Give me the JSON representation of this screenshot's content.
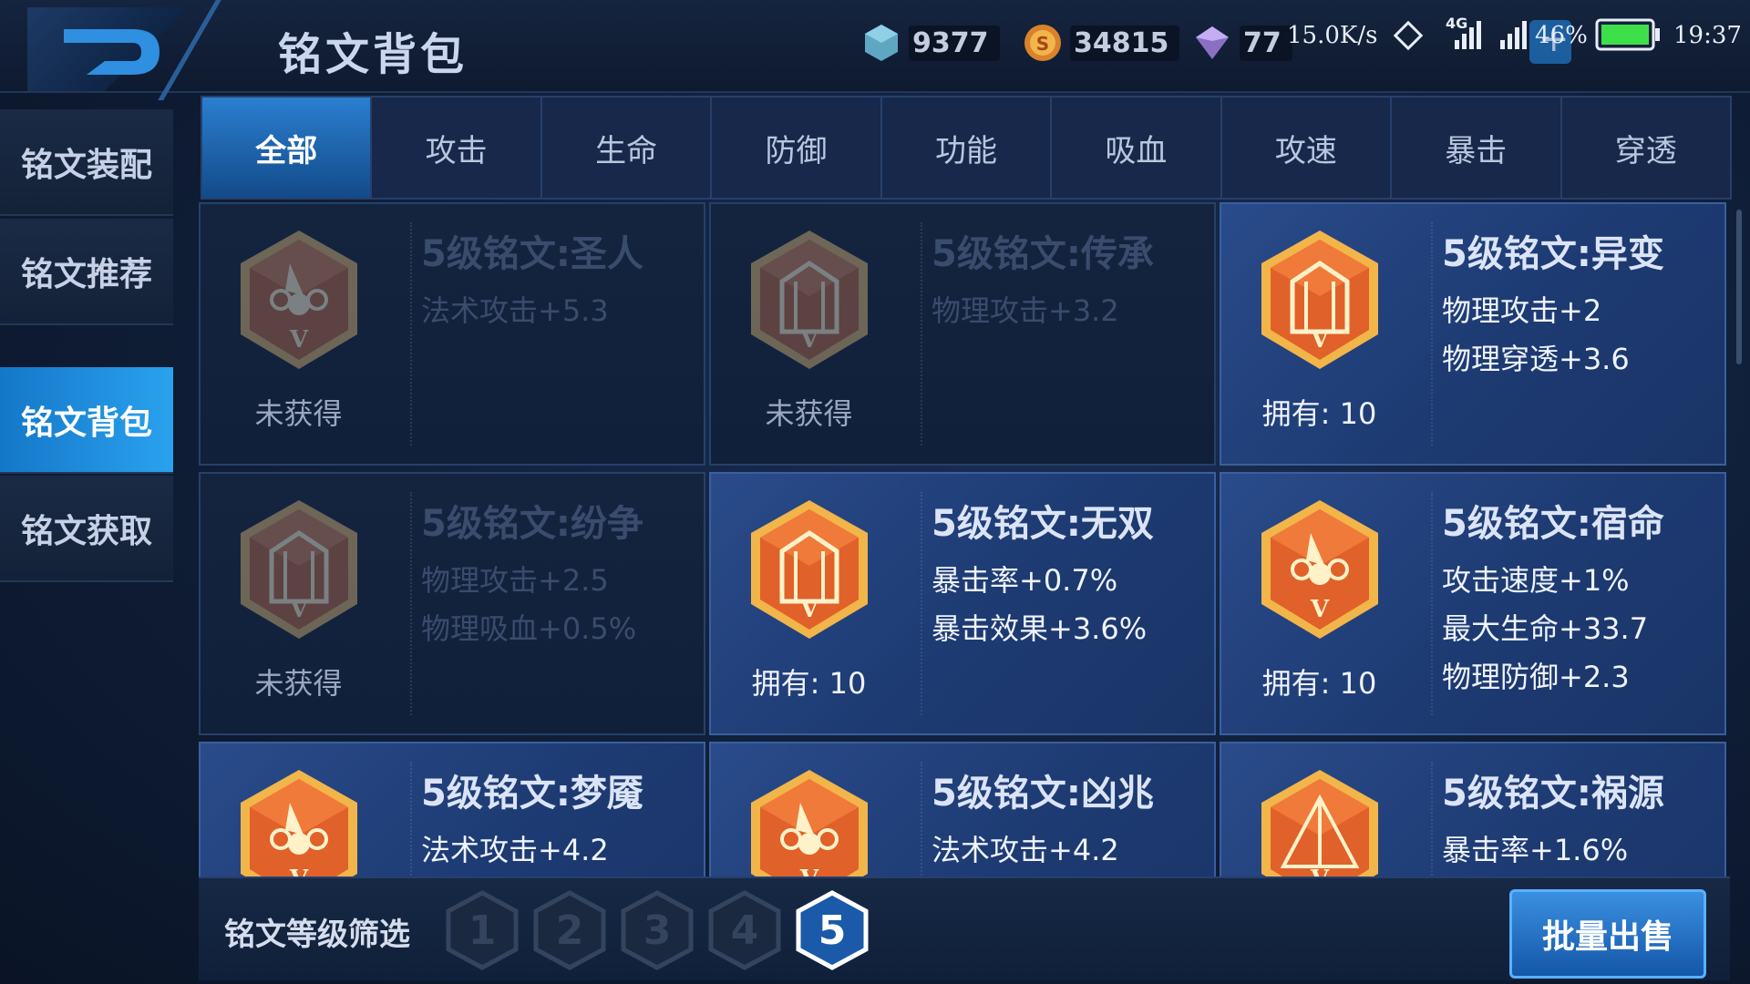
{
  "header": {
    "title": "铭文背包",
    "currencies": [
      {
        "icon": "diamond-gem-icon",
        "value": "9377"
      },
      {
        "icon": "gold-coin-icon",
        "value": "34815"
      },
      {
        "icon": "purple-crystal-icon",
        "value": "77"
      }
    ],
    "status": {
      "net_speed": "15.0K/s",
      "battery": "46%",
      "time": "19:37",
      "network": "4G"
    }
  },
  "sidebar": {
    "items": [
      {
        "label": "铭文装配"
      },
      {
        "label": "铭文推荐"
      },
      {
        "label": "铭文背包"
      },
      {
        "label": "铭文获取"
      }
    ],
    "active_index": 2
  },
  "tabs": {
    "items": [
      "全部",
      "攻击",
      "生命",
      "防御",
      "功能",
      "吸血",
      "攻速",
      "暴击",
      "穿透"
    ],
    "active_index": 0
  },
  "inscriptions": [
    {
      "title": "5级铭文:圣人",
      "stats": [
        "法术攻击+5.3"
      ],
      "status": "未获得",
      "owned": false,
      "emblem": "flower"
    },
    {
      "title": "5级铭文:传承",
      "stats": [
        "物理攻击+3.2"
      ],
      "status": "未获得",
      "owned": false,
      "emblem": "gate"
    },
    {
      "title": "5级铭文:异变",
      "stats": [
        "物理攻击+2",
        "物理穿透+3.6"
      ],
      "status": "拥有: 10",
      "owned": true,
      "emblem": "gate"
    },
    {
      "title": "5级铭文:纷争",
      "stats": [
        "物理攻击+2.5",
        "物理吸血+0.5%"
      ],
      "status": "未获得",
      "owned": false,
      "emblem": "gate"
    },
    {
      "title": "5级铭文:无双",
      "stats": [
        "暴击率+0.7%",
        "暴击效果+3.6%"
      ],
      "status": "拥有: 10",
      "owned": true,
      "emblem": "gate"
    },
    {
      "title": "5级铭文:宿命",
      "stats": [
        "攻击速度+1%",
        "最大生命+33.7",
        "物理防御+2.3"
      ],
      "status": "拥有: 10",
      "owned": true,
      "emblem": "flower"
    },
    {
      "title": "5级铭文:梦魇",
      "stats": [
        "法术攻击+4.2"
      ],
      "status": "",
      "owned": true,
      "emblem": "flower"
    },
    {
      "title": "5级铭文:凶兆",
      "stats": [
        "法术攻击+4.2"
      ],
      "status": "",
      "owned": true,
      "emblem": "flower"
    },
    {
      "title": "5级铭文:祸源",
      "stats": [
        "暴击率+1.6%"
      ],
      "status": "",
      "owned": true,
      "emblem": "shard"
    }
  ],
  "filter": {
    "label": "铭文等级筛选",
    "levels": [
      "1",
      "2",
      "3",
      "4",
      "5"
    ],
    "active_level": "5"
  },
  "actions": {
    "bulk_sell": "批量出售"
  },
  "colors": {
    "accent_blue": "#2aa2ee",
    "emblem_orange": "#e0612a",
    "emblem_gold": "#f2b54a"
  }
}
